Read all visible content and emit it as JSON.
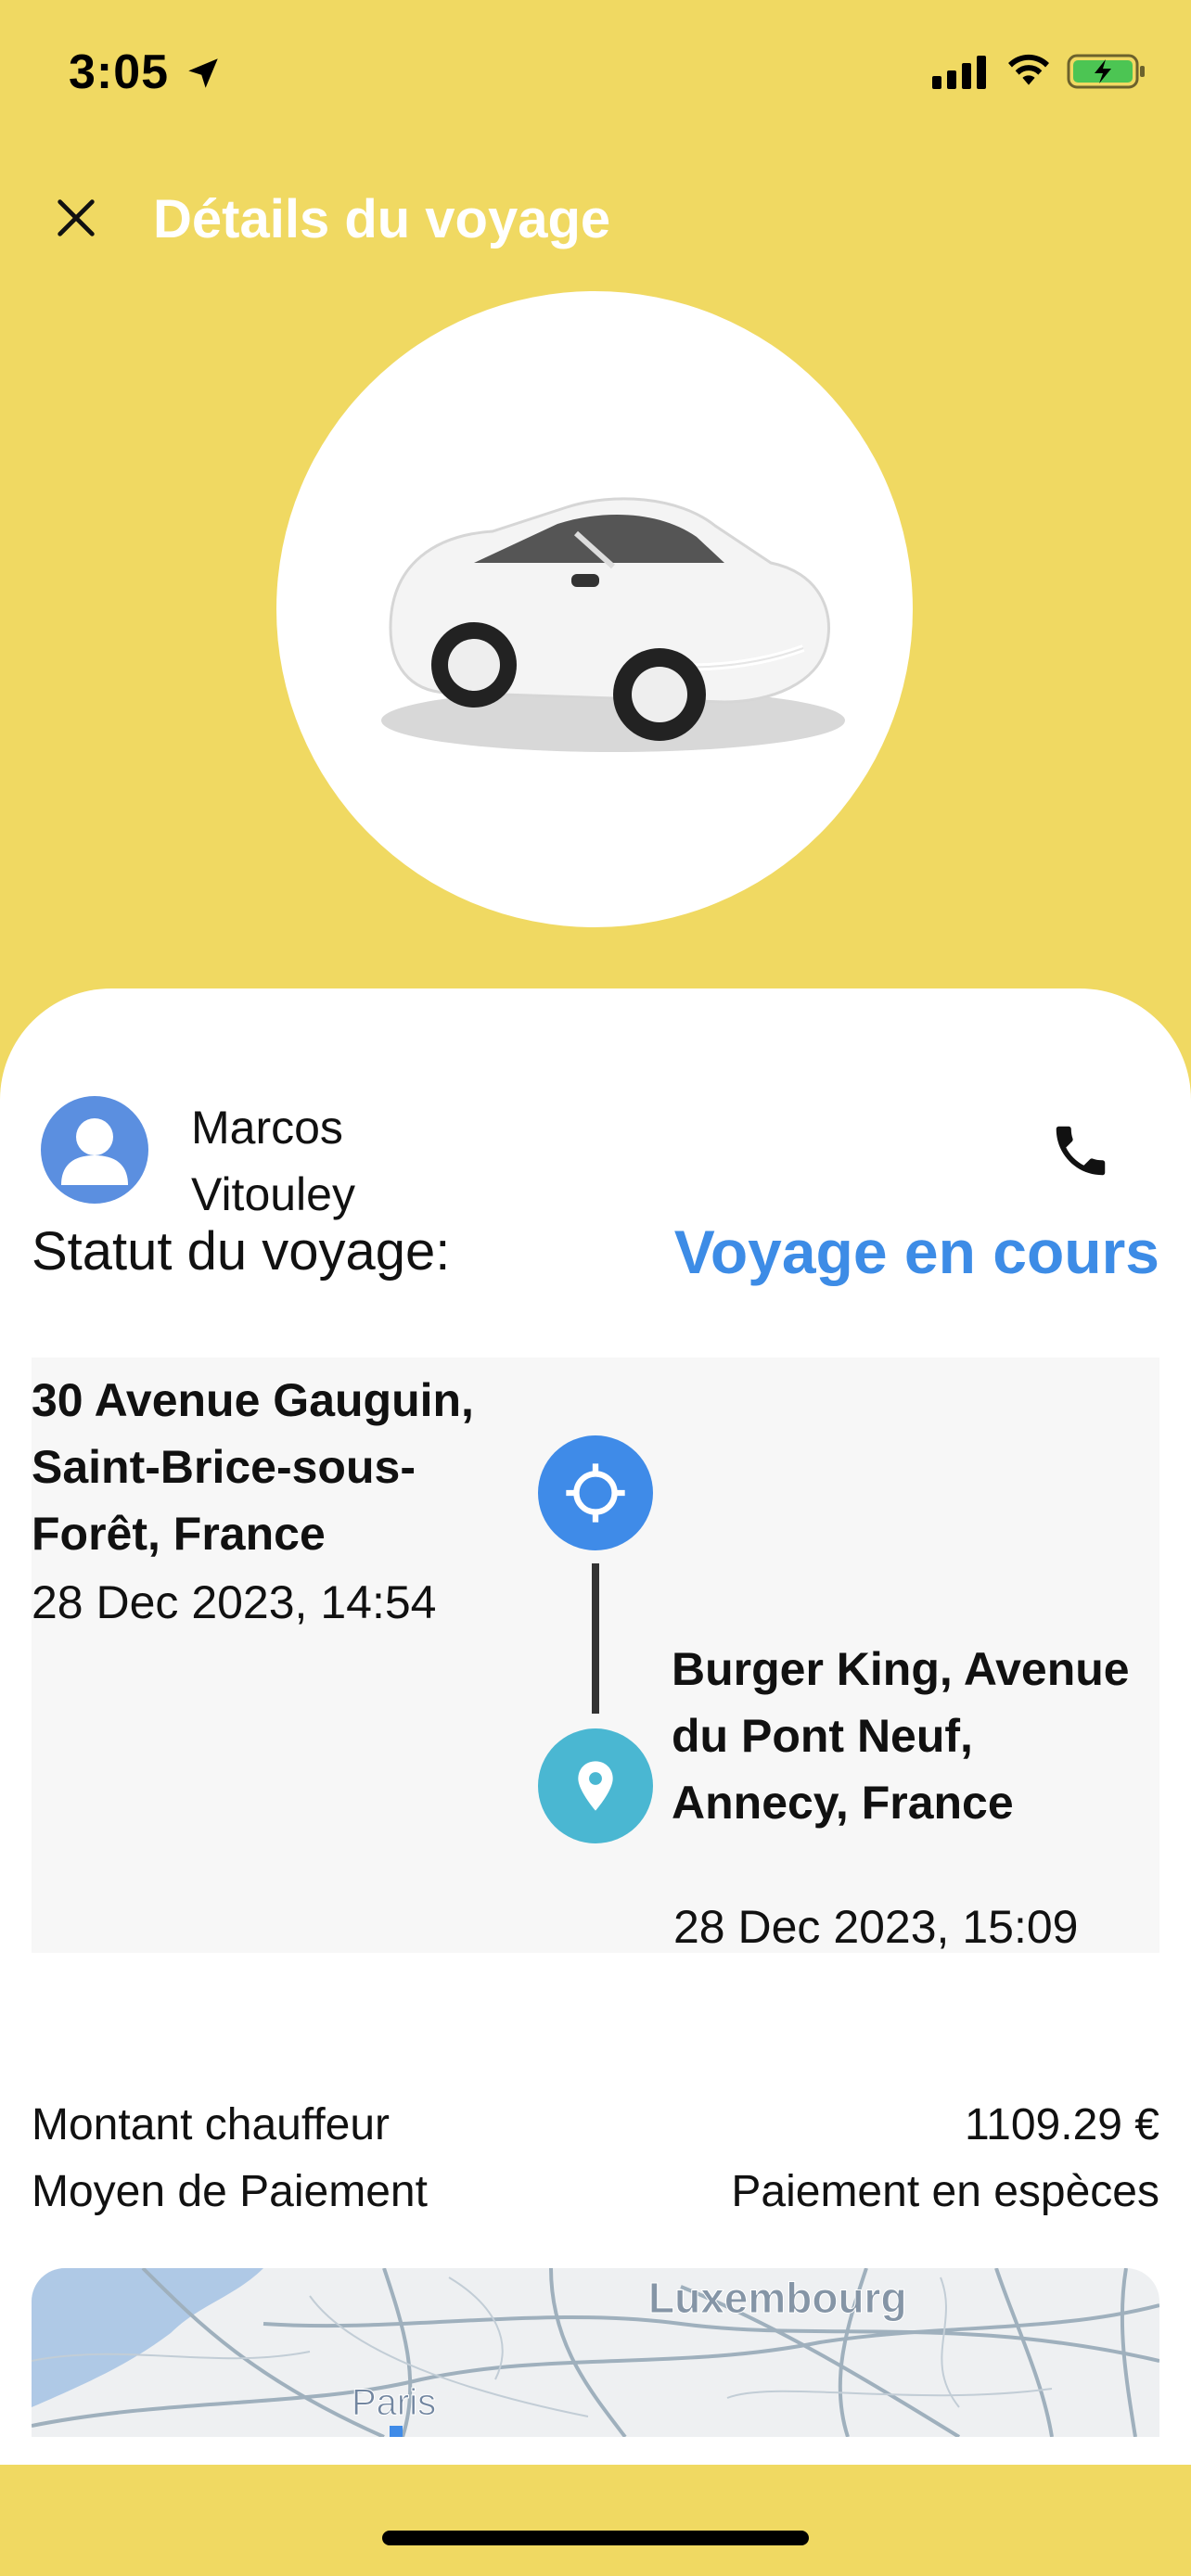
{
  "status_bar": {
    "time": "3:05",
    "icons": [
      "location-arrow-icon",
      "cellular-signal-icon",
      "wifi-icon",
      "battery-charging-icon"
    ]
  },
  "header": {
    "title": "Détails du voyage",
    "close_icon": "close-icon"
  },
  "vehicle": {
    "image": "white-car"
  },
  "driver": {
    "first_name": "Marcos",
    "last_name": "Vitouley",
    "avatar_icon": "user-icon",
    "call_icon": "phone-icon"
  },
  "trip_status": {
    "label": "Statut du voyage:",
    "value": "Voyage en cours"
  },
  "route": {
    "pickup": {
      "address": "30 Avenue Gauguin, Saint-Brice-sous-Forêt, France",
      "time": "28 Dec 2023, 14:54",
      "icon": "crosshair-icon"
    },
    "dropoff": {
      "address": "Burger King, Avenue du Pont Neuf, Annecy, France",
      "time": "28 Dec 2023, 15:09",
      "icon": "map-pin-icon"
    }
  },
  "payment": {
    "driver_amount_label": "Montant chauffeur",
    "driver_amount_value": "1109.29 €",
    "method_label": "Moyen de Paiement",
    "method_value": "Paiement en espèces"
  },
  "map": {
    "labels": [
      "Luxembourg",
      "Paris"
    ]
  },
  "colors": {
    "background": "#F0D962",
    "accent_blue": "#3D8CE6",
    "pickup_blue": "#3F8BE8",
    "dropoff_teal": "#4AB7D2",
    "avatar_blue": "#5B8FE0"
  }
}
